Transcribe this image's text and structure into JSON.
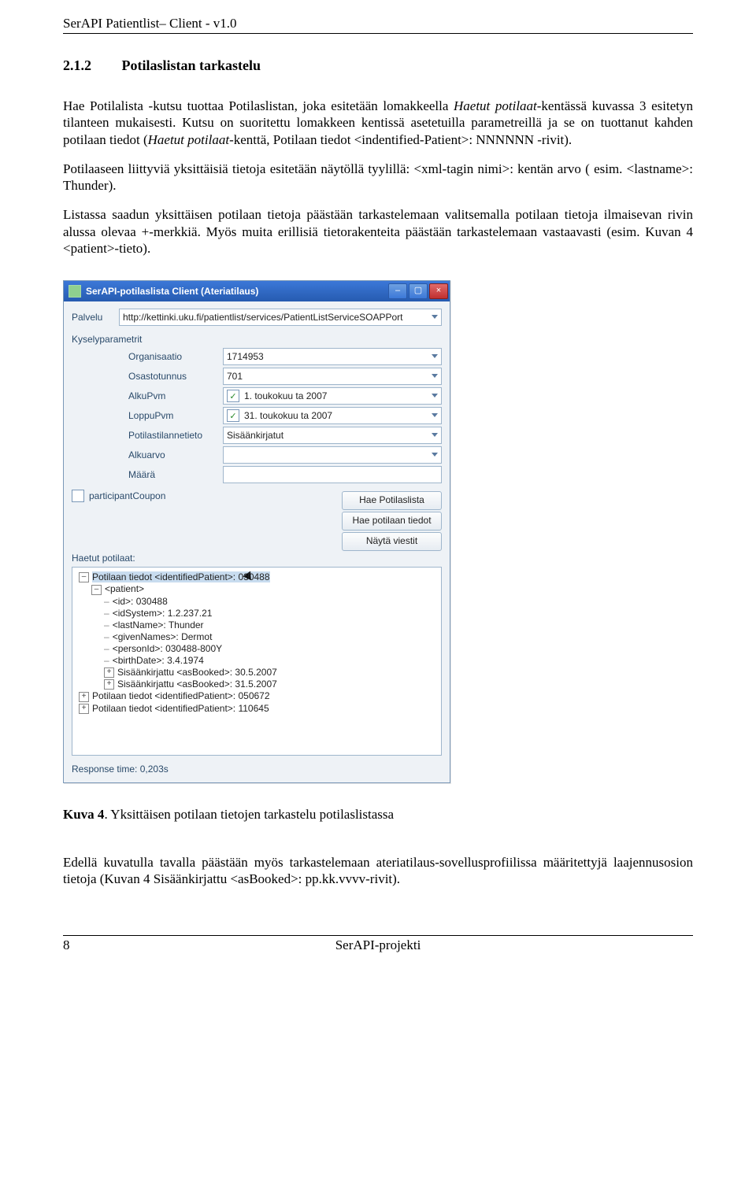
{
  "header": "SerAPI Patientlist– Client -  v1.0",
  "section": {
    "num": "2.1.2",
    "title": "Potilaslistan tarkastelu"
  },
  "p1_a": "Hae Potilalista -kutsu tuottaa Potilaslistan, joka esitetään lomakkeella ",
  "p1_i1": "Haetut potilaat",
  "p1_b": "-kentässä kuvassa 3 esitetyn tilanteen mukaisesti. Kutsu on suoritettu lomakkeen kentissä asetetuilla parametreillä ja se on tuottanut kahden potilaan tiedot (",
  "p1_i2": "Haetut potilaat",
  "p1_c": "-kenttä, Potilaan tiedot <indentified-Patient>: NNNNNN -rivit).",
  "p2": "Potilaaseen liittyviä yksittäisiä tietoja esitetään näytöllä tyylillä: <xml-tagin nimi>: kentän arvo ( esim. <lastname>: Thunder).",
  "p3": "Listassa saadun yksittäisen potilaan tietoja päästään tarkastelemaan valitsemalla potilaan tietoja ilmaisevan rivin alussa olevaa +-merkkiä.  Myös muita erillisiä tietorakenteita päästään tarkastelemaan vastaavasti (esim. Kuvan 4 <patient>-tieto).",
  "win": {
    "title": "SerAPI-potilaslista Client (Ateriatilaus)",
    "palvelu_lbl": "Palvelu",
    "palvelu_val": "http://kettinki.uku.fi/patientlist/services/PatientListServiceSOAPPort",
    "kysely_lbl": "Kyselyparametrit",
    "form": {
      "org_lbl": "Organisaatio",
      "org_val": "1714953",
      "osasto_lbl": "Osastotunnus",
      "osasto_val": "701",
      "alku_lbl": "AlkuPvm",
      "alku_val": "1.  toukokuu   ta 2007",
      "loppu_lbl": "LoppuPvm",
      "loppu_val": "31.  toukokuu   ta 2007",
      "tilanne_lbl": "Potilastilannetieto",
      "tilanne_val": "Sisäänkirjatut",
      "alkuarvo_lbl": "Alkuarvo",
      "alkuarvo_val": "",
      "maara_lbl": "Määrä",
      "maara_val": ""
    },
    "coupon_lbl": "participantCoupon",
    "buttons": {
      "b1": "Hae Potilaslista",
      "b2": "Hae potilaan tiedot",
      "b3": "Näytä viestit"
    },
    "haetut_lbl": "Haetut potilaat:",
    "tree": {
      "r1": "Potilaan tiedot <identifiedPatient>: 030488",
      "r1b": "<patient>",
      "l1": "<id>: 030488",
      "l2": "<idSystem>: 1.2.237.21",
      "l3": "<lastName>: Thunder",
      "l4": "<givenNames>: Dermot",
      "l5": "<personId>: 030488-800Y",
      "l6": "<birthDate>: 3.4.1974",
      "l7": "Sisäänkirjattu <asBooked>: 30.5.2007",
      "l8": "Sisäänkirjattu <asBooked>: 31.5.2007",
      "r2": "Potilaan tiedot <identifiedPatient>: 050672",
      "r3": "Potilaan tiedot <identifiedPatient>: 110645"
    },
    "status": "Response time: 0,203s"
  },
  "caption_b": "Kuva 4",
  "caption_t": ". Yksittäisen potilaan tietojen tarkastelu potilaslistassa",
  "p4": "Edellä kuvatulla tavalla päästään myös tarkastelemaan ateriatilaus-sovellusprofiilissa määritettyjä laajennusosion tietoja (Kuvan 4 Sisäänkirjattu <asBooked>: pp.kk.vvvv-rivit).",
  "footer": {
    "page": "8",
    "title": "SerAPI-projekti"
  }
}
